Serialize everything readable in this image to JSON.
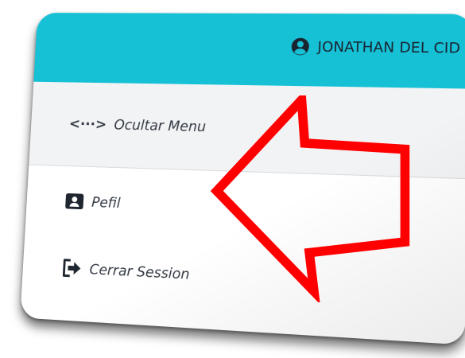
{
  "header": {
    "user_name": "JONATHAN DEL CID",
    "icon": "user-circle-icon"
  },
  "menu": {
    "hide_menu": {
      "label": "Ocultar Menu",
      "icon": "code-arrows-icon",
      "glyph": "<···>"
    },
    "profile": {
      "label": "Pefil",
      "icon": "id-card-icon"
    },
    "logout": {
      "label": "Cerrar Session",
      "icon": "sign-out-icon"
    }
  },
  "colors": {
    "header_bg": "#16c1d6",
    "arrow": "#ff0000",
    "text": "#333a44"
  }
}
